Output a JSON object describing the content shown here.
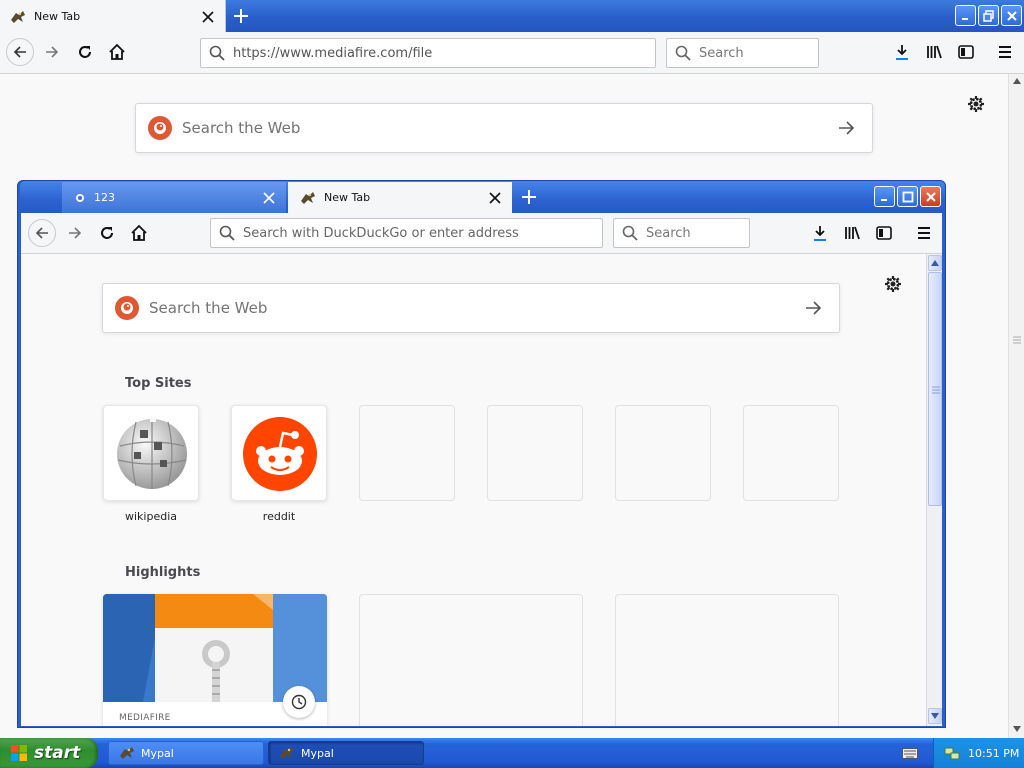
{
  "outer_browser": {
    "tab": {
      "title": "New Tab"
    },
    "url": "https://www.mediafire.com/file",
    "search_placeholder": "Search",
    "page": {
      "search_placeholder": "Search the Web"
    }
  },
  "inner_browser": {
    "tabs": [
      {
        "title": "123"
      },
      {
        "title": "New Tab"
      }
    ],
    "url_placeholder": "Search with DuckDuckGo or enter address",
    "search_placeholder": "Search",
    "page": {
      "search_placeholder": "Search the Web",
      "top_sites_title": "Top Sites",
      "top_sites": [
        {
          "label": "wikipedia",
          "icon": "wikipedia-globe-icon"
        },
        {
          "label": "reddit",
          "icon": "reddit-icon"
        }
      ],
      "highlights_title": "Highlights",
      "highlights": [
        {
          "source": "MEDIAFIRE"
        }
      ]
    }
  },
  "taskbar": {
    "start_label": "start",
    "tasks": [
      {
        "label": "Mypal",
        "active": false
      },
      {
        "label": "Mypal",
        "active": true
      }
    ],
    "clock": "10:51 PM"
  },
  "colors": {
    "xp_blue": "#2a5fc9",
    "start_green": "#37983a",
    "ddg_orange": "#de5833",
    "reddit_orange": "#ff4500",
    "download_accent": "#0a84ff"
  }
}
